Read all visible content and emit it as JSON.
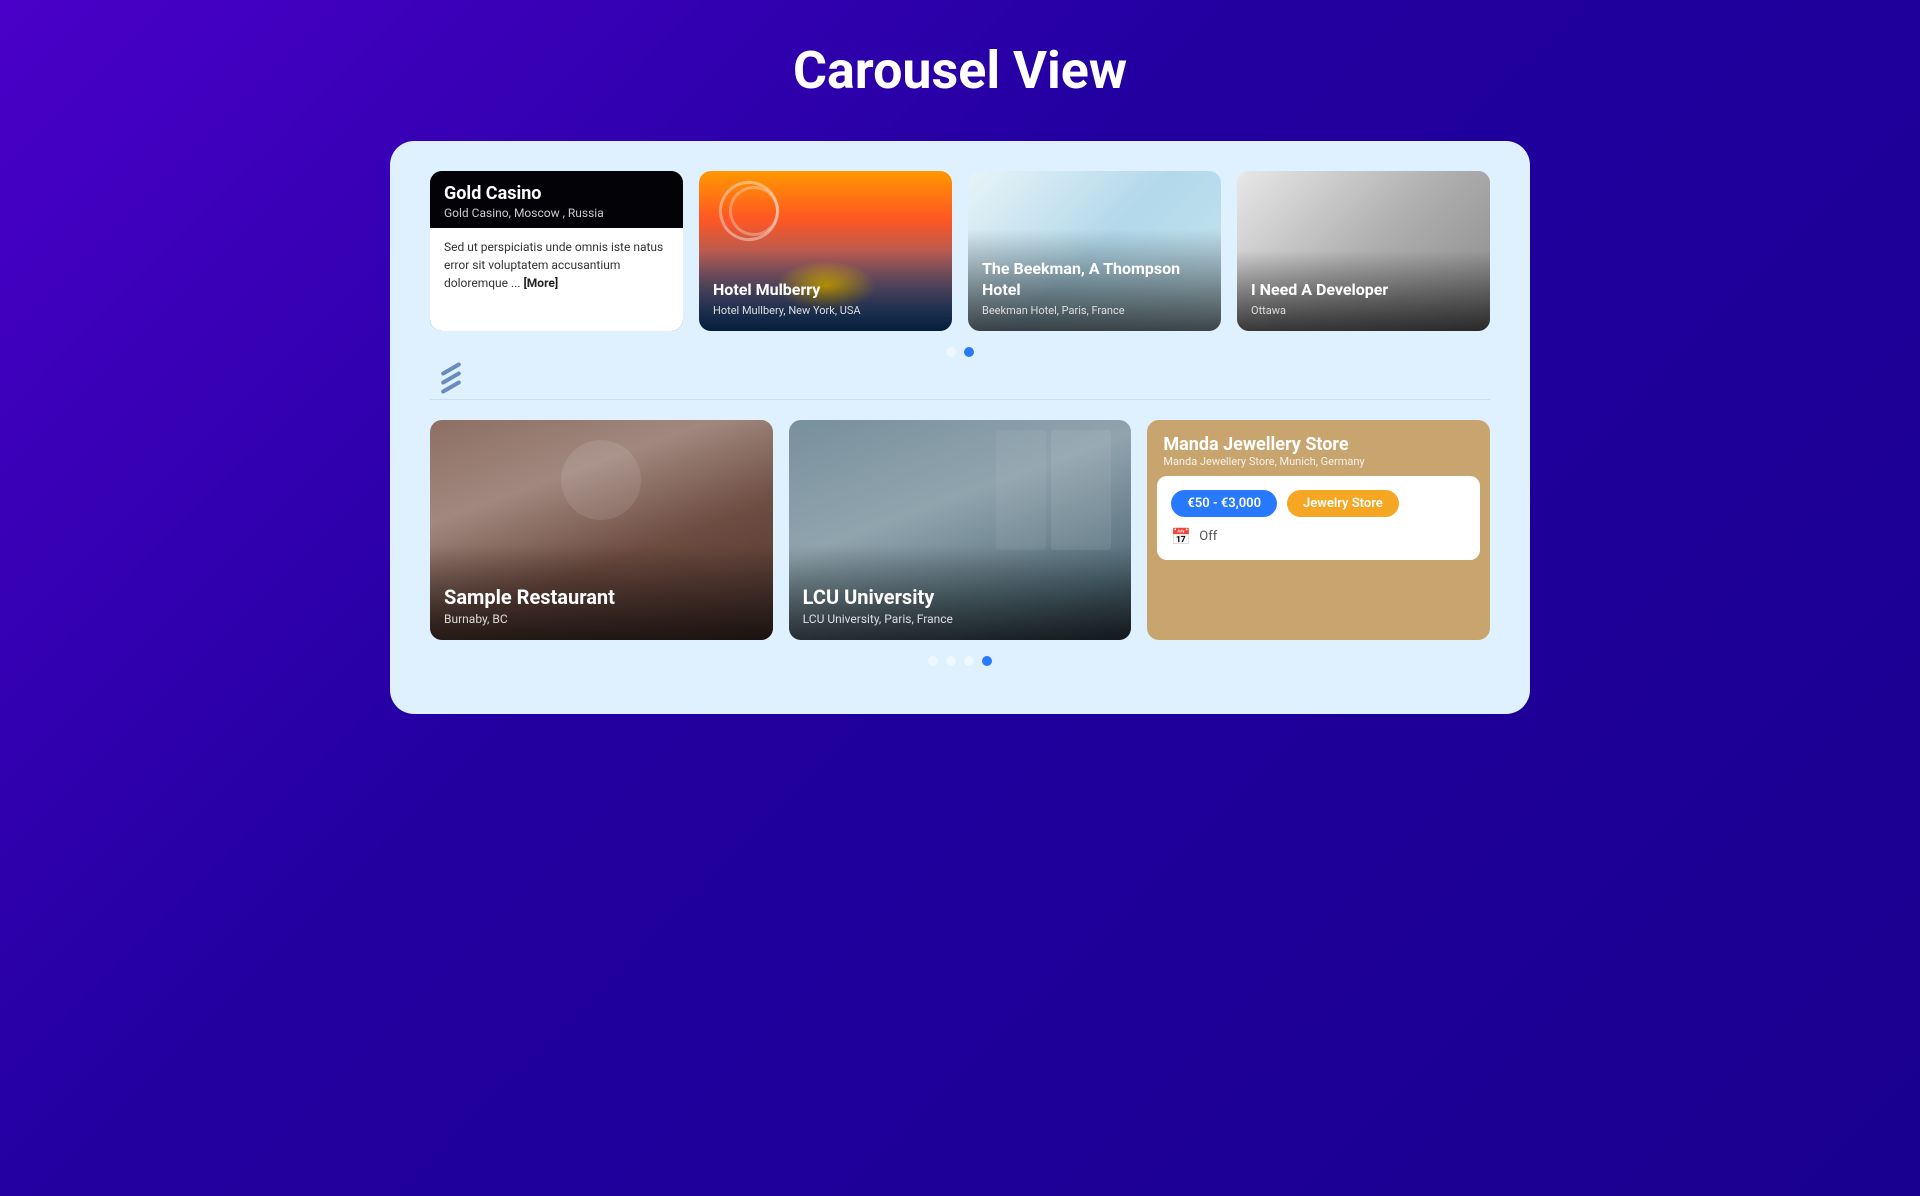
{
  "page": {
    "title": "Carousel View"
  },
  "topCarousel": {
    "dots": [
      {
        "active": false
      },
      {
        "active": true
      }
    ],
    "cards": [
      {
        "id": "gold-casino",
        "type": "text-popup",
        "title": "Gold Casino",
        "subtitle": "Gold Casino, Moscow , Russia",
        "description": "Sed ut perspiciatis unde omnis iste natus error sit voluptatem accusantium doloremque ...",
        "more_label": "[More]"
      },
      {
        "id": "hotel-mulberry",
        "type": "image",
        "title": "Hotel Mulberry",
        "subtitle": "Hotel Mullbery, New York, USA",
        "bgClass": "bg-hotel"
      },
      {
        "id": "beekman",
        "type": "image",
        "title": "The Beekman, A Thompson Hotel",
        "subtitle": "Beekman Hotel, Paris, France",
        "bgClass": "bg-beekman"
      },
      {
        "id": "developer",
        "type": "image",
        "title": "I Need A Developer",
        "subtitle": "Ottawa",
        "bgClass": "bg-developer"
      }
    ]
  },
  "bottomCarousel": {
    "dots": [
      {
        "active": false
      },
      {
        "active": false
      },
      {
        "active": false
      },
      {
        "active": true
      }
    ],
    "cards": [
      {
        "id": "restaurant",
        "type": "image",
        "title": "Sample Restaurant",
        "subtitle": "Burnaby, BC",
        "bgClass": "bg-restaurant"
      },
      {
        "id": "university",
        "type": "image",
        "title": "LCU University",
        "subtitle": "LCU University, Paris, France",
        "bgClass": "bg-university"
      },
      {
        "id": "jewelry",
        "type": "info-card",
        "title": "Manda Jewellery Store",
        "subtitle": "Manda Jewellery Store, Munich, Germany",
        "price_range": "€50 - €3,000",
        "category": "Jewelry Store",
        "status": "Off",
        "bgClass": "bg-jewelry"
      }
    ]
  }
}
